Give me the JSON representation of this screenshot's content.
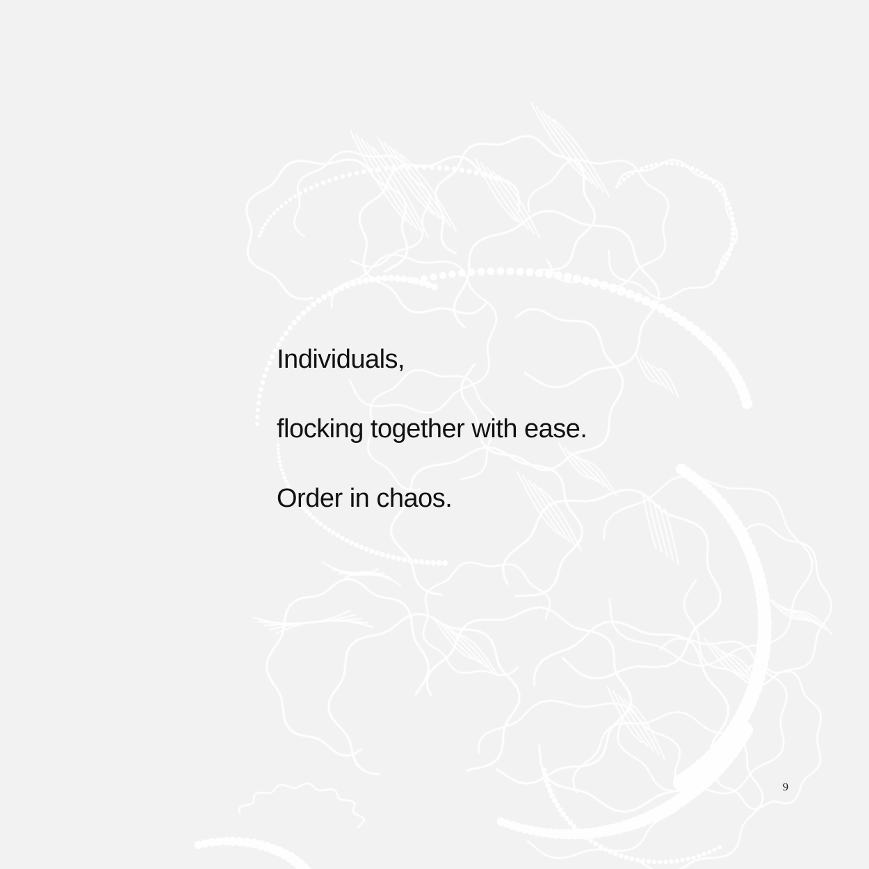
{
  "poem": {
    "lines": [
      "Individuals,",
      "flocking together with ease.",
      "Order in chaos."
    ]
  },
  "page_number": "9",
  "illustration": {
    "name": "flocking-trails-illustration",
    "color": "#ffffff"
  },
  "colors": {
    "background": "#f2f2f2",
    "text": "#111111"
  }
}
